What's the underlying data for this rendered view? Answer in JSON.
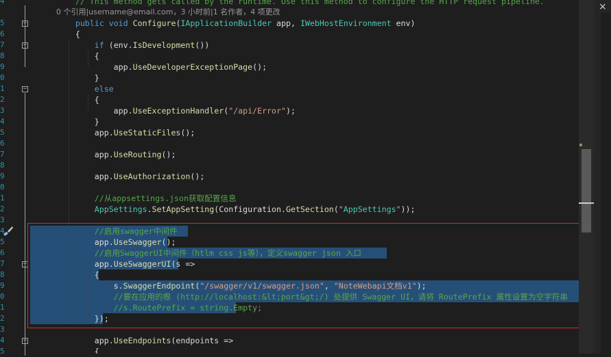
{
  "lines": [
    {
      "n": "4",
      "text": "        // This method gets called by the runtime. Use this method to configure the HTTP request pipeline.",
      "cls": "c"
    },
    {
      "n": "",
      "text": "        0 个引用|username@email.com，3 小时前|1 名作者，4 项更改",
      "cls": "lens"
    },
    {
      "n": "5",
      "text": "        public void Configure(IApplicationBuilder app, IWebHostEnvironment env)",
      "cls": ""
    },
    {
      "n": "6",
      "text": "        {",
      "cls": ""
    },
    {
      "n": "7",
      "text": "            if (env.IsDevelopment())",
      "cls": ""
    },
    {
      "n": "8",
      "text": "            {",
      "cls": ""
    },
    {
      "n": "9",
      "text": "                app.UseDeveloperExceptionPage();",
      "cls": ""
    },
    {
      "n": "0",
      "text": "            }",
      "cls": ""
    },
    {
      "n": "1",
      "text": "            else",
      "cls": ""
    },
    {
      "n": "2",
      "text": "            {",
      "cls": ""
    },
    {
      "n": "3",
      "text": "                app.UseExceptionHandler(\"/api/Error\");",
      "cls": ""
    },
    {
      "n": "4",
      "text": "            }",
      "cls": ""
    },
    {
      "n": "5",
      "text": "            app.UseStaticFiles();",
      "cls": ""
    },
    {
      "n": "6",
      "text": "",
      "cls": ""
    },
    {
      "n": "7",
      "text": "            app.UseRouting();",
      "cls": ""
    },
    {
      "n": "8",
      "text": "",
      "cls": ""
    },
    {
      "n": "9",
      "text": "            app.UseAuthorization();",
      "cls": ""
    },
    {
      "n": "0",
      "text": "",
      "cls": ""
    },
    {
      "n": "1",
      "text": "            //从appsettings.json获取配置信息",
      "cls": "c"
    },
    {
      "n": "2",
      "text": "            AppSettings.SetAppSetting(Configuration.GetSection(\"AppSettings\"));",
      "cls": ""
    },
    {
      "n": "3",
      "text": "",
      "cls": ""
    },
    {
      "n": "4",
      "text": "            //启用swagger中间件",
      "cls": "c"
    },
    {
      "n": "5",
      "text": "            app.UseSwagger();",
      "cls": ""
    },
    {
      "n": "6",
      "text": "            //启用SwaggerUI中间件（htlm css js等），定义swagger json 入口",
      "cls": "c"
    },
    {
      "n": "7",
      "text": "            app.UseSwaggerUI(s =>",
      "cls": ""
    },
    {
      "n": "8",
      "text": "            {",
      "cls": ""
    },
    {
      "n": "9",
      "text": "                s.SwaggerEndpoint(\"/swagger/v1/swagger.json\", \"NoteWebapi文档v1\");",
      "cls": ""
    },
    {
      "n": "0",
      "text": "                //要在应用的根 (http://localhost:&lt;port&gt;/) 处提供 Swagger UI，请将 RoutePrefix 属性设置为空字符串",
      "cls": "c"
    },
    {
      "n": "1",
      "text": "                //s.RoutePrefix = string.Empty;",
      "cls": "c"
    },
    {
      "n": "2",
      "text": "            });",
      "cls": ""
    },
    {
      "n": "3",
      "text": "",
      "cls": ""
    },
    {
      "n": "4",
      "text": "            app.UseEndpoints(endpoints =>",
      "cls": ""
    },
    {
      "n": "5",
      "text": "            {",
      "cls": ""
    }
  ],
  "pane": {
    "close_label": "×"
  },
  "icons": {
    "brush": "paintbrush-icon",
    "close": "close-icon"
  }
}
